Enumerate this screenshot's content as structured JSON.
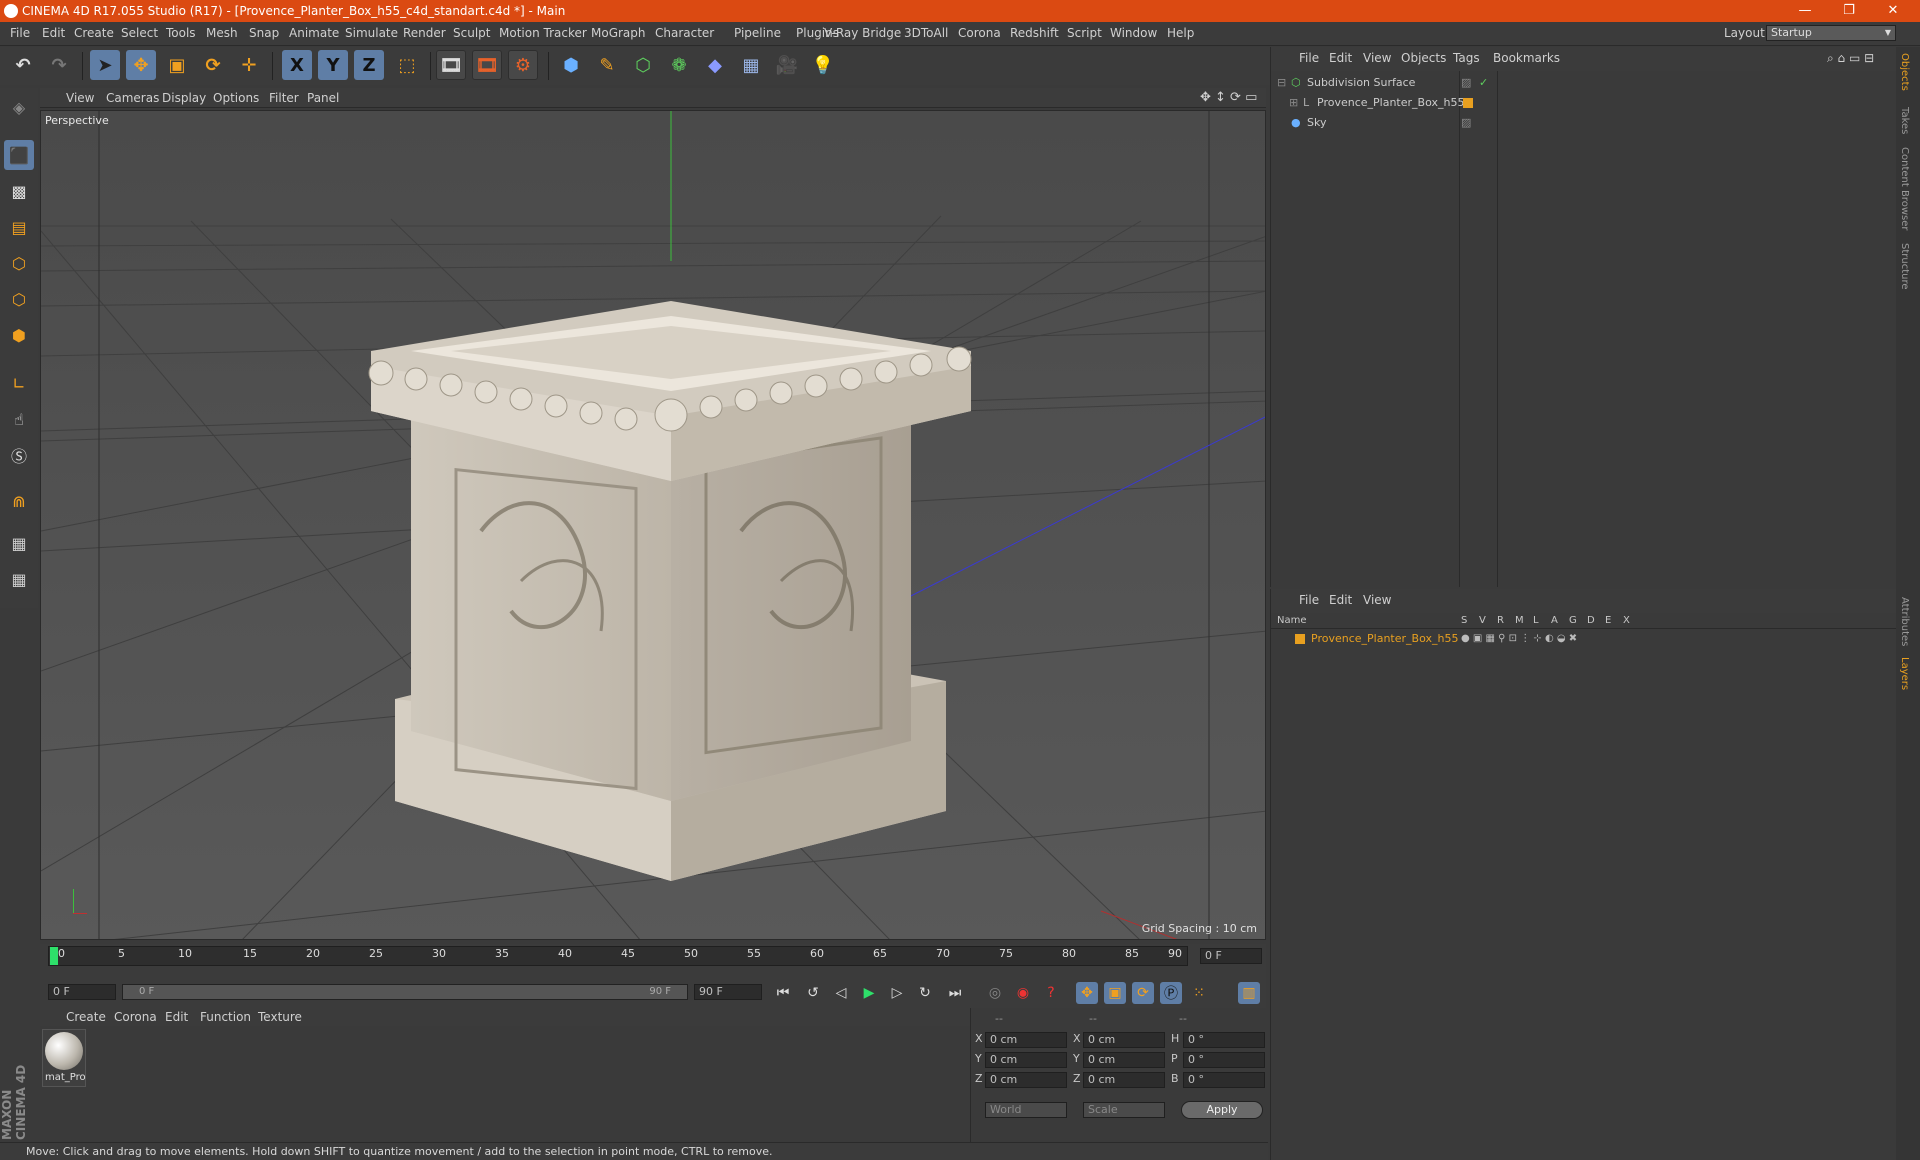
{
  "titlebar": {
    "title": "CINEMA 4D R17.055 Studio (R17) - [Provence_Planter_Box_h55_c4d_standart.c4d *] - Main",
    "minimize": "—",
    "maximize": "❐",
    "close": "✕"
  },
  "menubar": {
    "items": [
      "File",
      "Edit",
      "Create",
      "Select",
      "Tools",
      "Mesh",
      "Snap",
      "Animate",
      "Simulate",
      "Render",
      "Sculpt",
      "Motion Tracker",
      "MoGraph",
      "Character",
      "Pipeline",
      "Plugins",
      "V-Ray Bridge",
      "3DToAll",
      "Corona",
      "Redshift",
      "Script",
      "Window",
      "Help"
    ],
    "layout_label": "Layout:",
    "layout_value": "Startup"
  },
  "toolbar": {
    "x_axis": "X",
    "y_axis": "Y",
    "z_axis": "Z"
  },
  "viewport": {
    "menu": [
      "View",
      "Cameras",
      "Display",
      "Options",
      "Filter",
      "Panel"
    ],
    "label": "Perspective",
    "grid_spacing": "Grid Spacing : 10 cm"
  },
  "timeline": {
    "ticks": [
      "0",
      "5",
      "10",
      "15",
      "20",
      "25",
      "30",
      "35",
      "40",
      "45",
      "50",
      "55",
      "60",
      "65",
      "70",
      "75",
      "80",
      "85",
      "90"
    ],
    "frame_end_box": "0 F",
    "current_field": "0 F",
    "range_start": "0 F",
    "range_end": "90 F",
    "max_field": "90 F"
  },
  "material_manager": {
    "menu": [
      "Create",
      "Corona",
      "Edit",
      "Function",
      "Texture"
    ],
    "material_name": "mat_Pro"
  },
  "coordinates": {
    "headers": [
      "--",
      "--",
      "--"
    ],
    "rows": [
      {
        "a": "X",
        "av": "0 cm",
        "b": "X",
        "bv": "0 cm",
        "c": "H",
        "cv": "0 °"
      },
      {
        "a": "Y",
        "av": "0 cm",
        "b": "Y",
        "bv": "0 cm",
        "c": "P",
        "cv": "0 °"
      },
      {
        "a": "Z",
        "av": "0 cm",
        "b": "Z",
        "bv": "0 cm",
        "c": "B",
        "cv": "0 °"
      }
    ],
    "world": "World",
    "scale": "Scale",
    "apply": "Apply"
  },
  "status": "Move: Click and drag to move elements. Hold down SHIFT to quantize movement / add to the selection in point mode, CTRL to remove.",
  "object_manager": {
    "menu": [
      "File",
      "Edit",
      "View",
      "Objects",
      "Tags",
      "Bookmarks"
    ],
    "objects": [
      "Subdivision Surface",
      "Provence_Planter_Box_h55",
      "Sky"
    ]
  },
  "layer_manager": {
    "menu": [
      "File",
      "Edit",
      "View"
    ],
    "name_header": "Name",
    "columns": [
      "S",
      "V",
      "R",
      "M",
      "L",
      "A",
      "G",
      "D",
      "E",
      "X"
    ],
    "layer": "Provence_Planter_Box_h55"
  },
  "right_tabs": [
    "Objects",
    "Takes",
    "Content Browser",
    "Structure",
    "Attributes",
    "Layers"
  ],
  "brand": "MAXON CINEMA 4D",
  "colors": {
    "accent": "#db4a12",
    "layer_orange": "#e8a020",
    "active_blue": "#5f7ea6"
  }
}
